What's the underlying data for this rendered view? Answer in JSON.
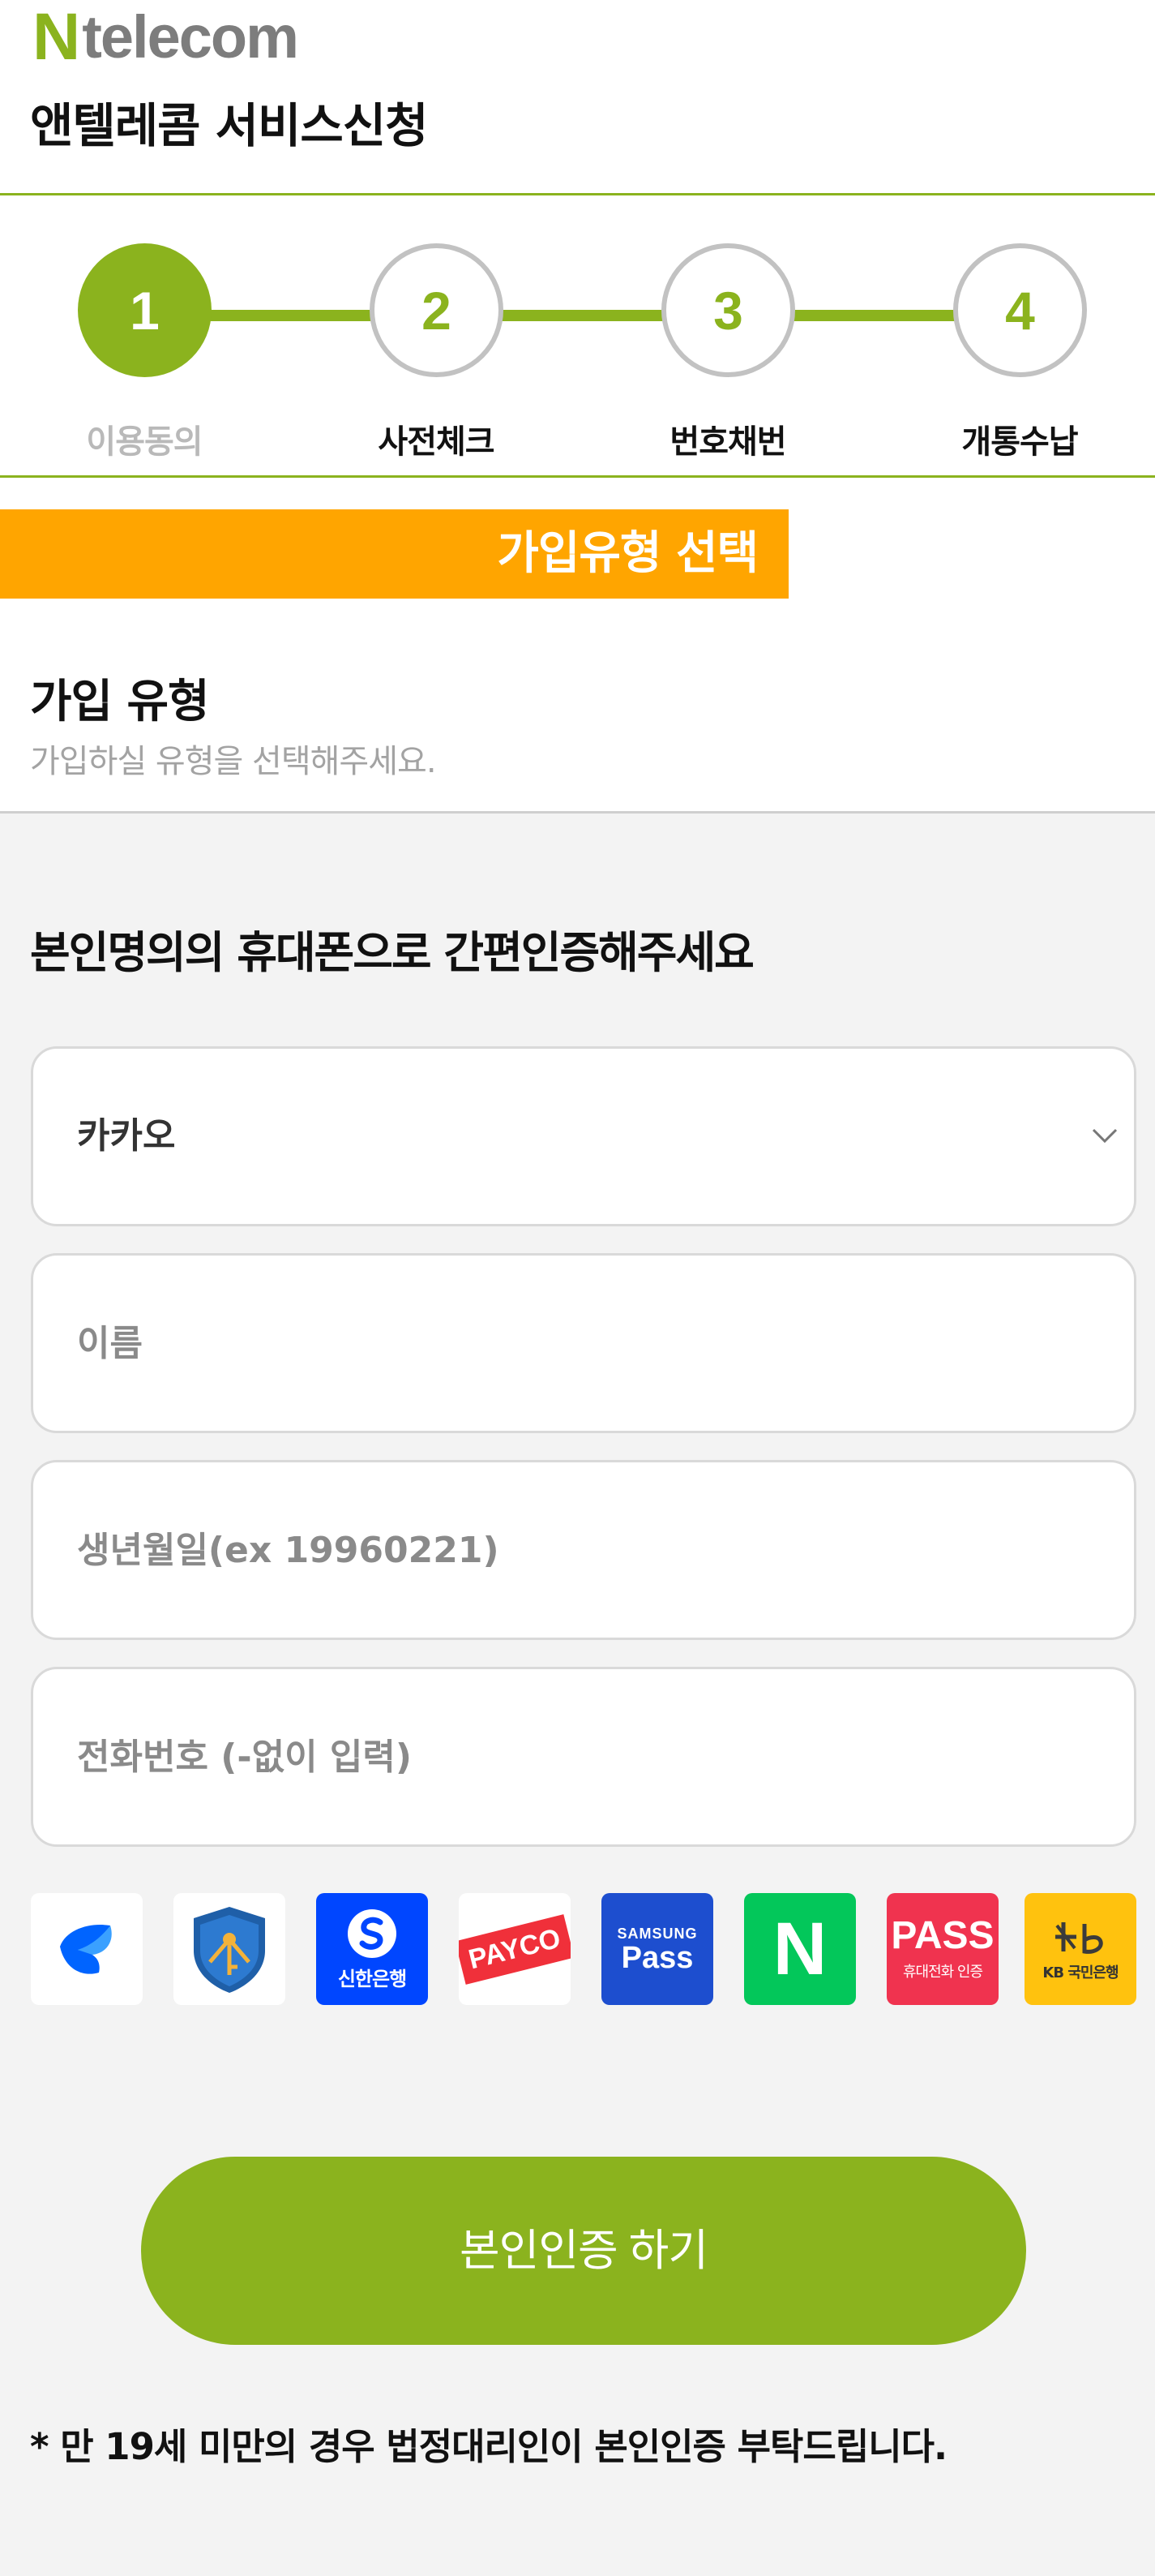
{
  "brand": {
    "logo_n": "N",
    "logo_rest": "telecom",
    "color": "#8bb31e"
  },
  "page_title": "앤텔레콤 서비스신청",
  "steps": [
    {
      "number": "1",
      "label": "이용동의",
      "state": "active"
    },
    {
      "number": "2",
      "label": "사전체크",
      "state": "pending"
    },
    {
      "number": "3",
      "label": "번호채번",
      "state": "pending"
    },
    {
      "number": "4",
      "label": "개통수납",
      "state": "pending"
    }
  ],
  "banner": {
    "text": "가입유형 선택",
    "color": "#ffa500"
  },
  "section": {
    "title": "가입 유형",
    "subtitle": "가입하실 유형을 선택해주세요."
  },
  "auth": {
    "title": "본인명의의 휴대폰으로 간편인증해주세요",
    "provider_select": {
      "value": "카카오"
    },
    "name_placeholder": "이름",
    "birth_placeholder": "생년월일(ex 19960221)",
    "phone_placeholder": "전화번호 (-없이 입력)",
    "providers": [
      {
        "name": "toss",
        "icon": "toss-icon"
      },
      {
        "name": "금융인증서",
        "icon": "shield-key-icon"
      },
      {
        "name": "신한은행",
        "icon": "shinhan-icon"
      },
      {
        "name": "PAYCO",
        "icon": "payco-icon"
      },
      {
        "name": "SAMSUNG Pass",
        "icon": "samsung-pass-icon",
        "line1": "SAMSUNG",
        "line2": "Pass"
      },
      {
        "name": "N",
        "icon": "naver-icon"
      },
      {
        "name": "PASS",
        "icon": "pass-icon",
        "line1": "PASS",
        "line2": "휴대전화 인증"
      },
      {
        "name": "KB국민은행",
        "icon": "kb-icon",
        "line1": "KB 국민은행"
      }
    ],
    "submit_label": "본인인증 하기"
  },
  "notice": "* 만 19세 미만의 경우 법정대리인이 본인인증 부탁드립니다."
}
